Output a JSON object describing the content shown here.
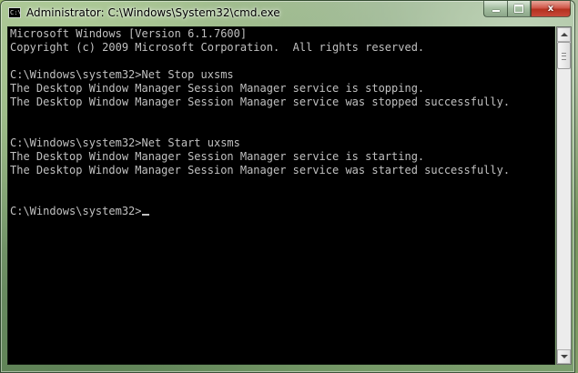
{
  "window": {
    "title": "Administrator: C:\\Windows\\System32\\cmd.exe",
    "icon": "cmd-icon",
    "controls": {
      "minimize": "minimize-icon",
      "maximize": "maximize-icon",
      "close_label": "x"
    }
  },
  "console": {
    "lines": [
      "Microsoft Windows [Version 6.1.7600]",
      "Copyright (c) 2009 Microsoft Corporation.  All rights reserved.",
      "",
      "C:\\Windows\\system32>Net Stop uxsms",
      "The Desktop Window Manager Session Manager service is stopping.",
      "The Desktop Window Manager Session Manager service was stopped successfully.",
      "",
      "",
      "C:\\Windows\\system32>Net Start uxsms",
      "The Desktop Window Manager Session Manager service is starting.",
      "The Desktop Window Manager Session Manager service was started successfully.",
      "",
      "",
      "C:\\Windows\\system32>"
    ],
    "text_color": "#c0c0c0",
    "background_color": "#000000"
  },
  "scrollbar": {
    "position": 0
  }
}
